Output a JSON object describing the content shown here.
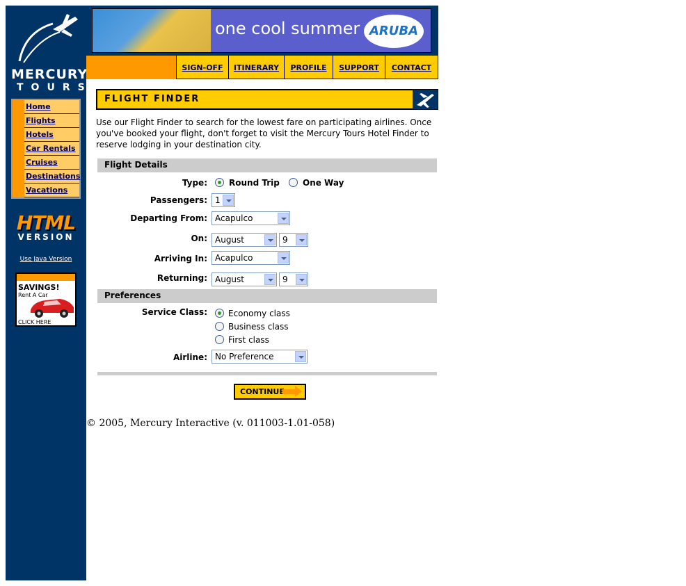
{
  "sidebar": {
    "brand_line1": "MERCURY",
    "brand_line2": "TOURS",
    "nav": [
      {
        "label": "Home"
      },
      {
        "label": "Flights"
      },
      {
        "label": "Hotels"
      },
      {
        "label": "Car Rentals"
      },
      {
        "label": "Cruises"
      },
      {
        "label": "Destinations"
      },
      {
        "label": "Vacations"
      }
    ],
    "html_version": {
      "big": "HTML",
      "small": "VERSION"
    },
    "java_link": "Use Java Version",
    "ad": {
      "line1": "SAVINGS!",
      "line2": "Rent A Car",
      "line3": "CLICK HERE"
    }
  },
  "banner": {
    "text": "one cool summer",
    "badge": "ARUBA"
  },
  "menu": [
    {
      "label": "SIGN-OFF"
    },
    {
      "label": "ITINERARY"
    },
    {
      "label": "PROFILE"
    },
    {
      "label": "SUPPORT"
    },
    {
      "label": "CONTACT"
    }
  ],
  "header": {
    "title": "FLIGHT FINDER"
  },
  "intro": "Use our Flight Finder to search for the lowest fare on participating airlines. Once you've booked your flight, don't forget to visit the Mercury Tours Hotel Finder to reserve lodging in your destination city.",
  "flight_details": {
    "section_title": "Flight Details",
    "type_label": "Type:",
    "type_options": [
      {
        "label": "Round Trip",
        "selected": true
      },
      {
        "label": "One Way",
        "selected": false
      }
    ],
    "passengers_label": "Passengers:",
    "passengers_value": "1",
    "departing_label": "Departing From:",
    "departing_value": "Acapulco",
    "on_label": "On:",
    "on_month": "August",
    "on_day": "9",
    "arriving_label": "Arriving In:",
    "arriving_value": "Acapulco",
    "returning_label": "Returning:",
    "returning_month": "August",
    "returning_day": "9"
  },
  "preferences": {
    "section_title": "Preferences",
    "class_label": "Service Class:",
    "class_options": [
      {
        "label": "Economy class",
        "selected": true
      },
      {
        "label": "Business class",
        "selected": false
      },
      {
        "label": "First class",
        "selected": false
      }
    ],
    "airline_label": "Airline:",
    "airline_value": "No Preference"
  },
  "continue_label": "CONTINUE",
  "footer": "© 2005, Mercury Interactive (v. 011003-1.01-058)",
  "colors": {
    "sidebar_bg": "#003366",
    "menu_orange": "#ff9900",
    "tab_yellow": "#ffcc00",
    "nav_bg": "#ffcc66",
    "section_gray": "#cccccc",
    "link": "#000066"
  }
}
